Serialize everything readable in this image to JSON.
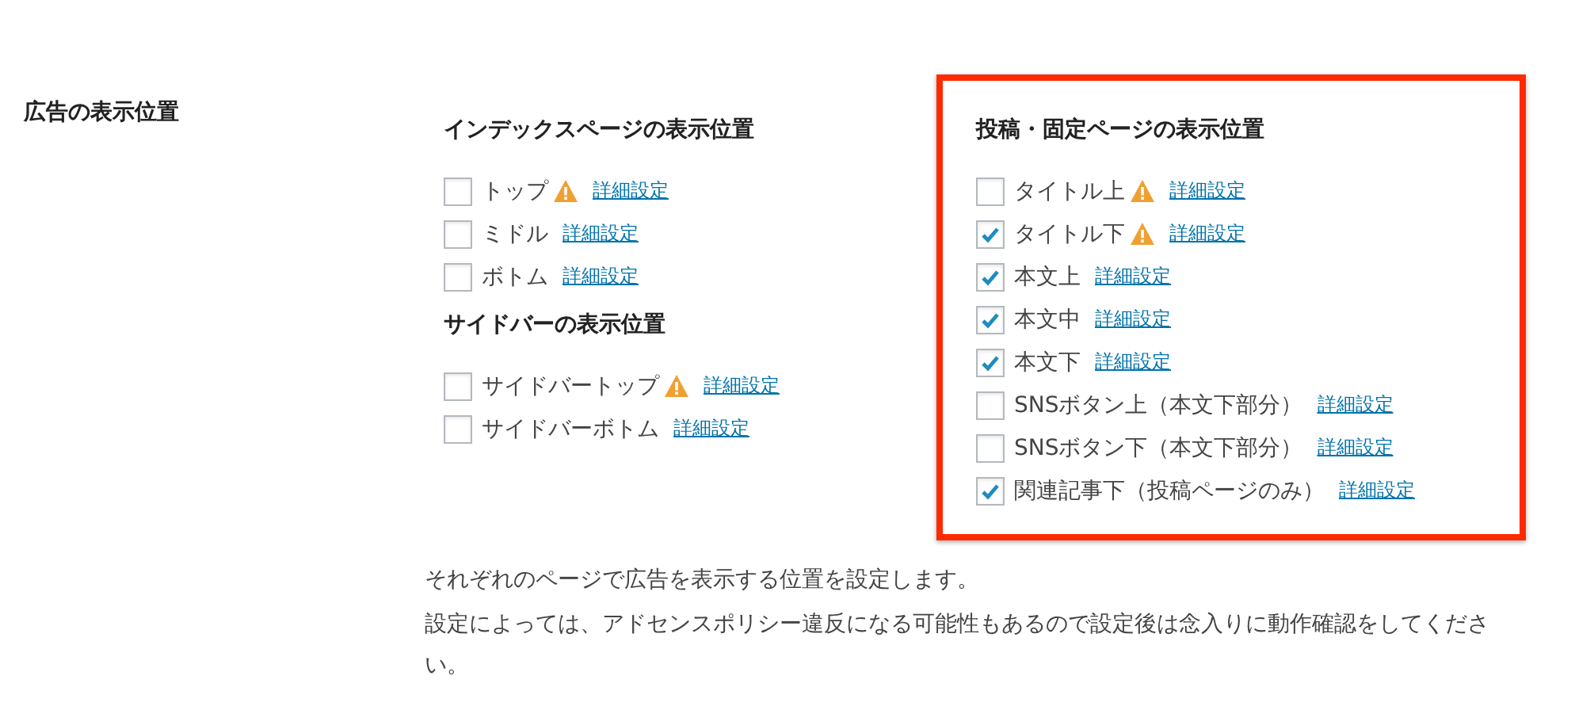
{
  "field_label": "広告の表示位置",
  "groups": [
    {
      "heading": "インデックスページの表示位置",
      "highlighted": false,
      "items": [
        {
          "label": "トップ",
          "checked": false,
          "warning": true,
          "link": "詳細設定"
        },
        {
          "label": "ミドル",
          "checked": false,
          "warning": false,
          "link": "詳細設定"
        },
        {
          "label": "ボトム",
          "checked": false,
          "warning": false,
          "link": "詳細設定"
        }
      ]
    },
    {
      "heading": "サイドバーの表示位置",
      "highlighted": false,
      "items": [
        {
          "label": "サイドバートップ",
          "checked": false,
          "warning": true,
          "link": "詳細設定"
        },
        {
          "label": "サイドバーボトム",
          "checked": false,
          "warning": false,
          "link": "詳細設定"
        }
      ]
    },
    {
      "heading": "投稿・固定ページの表示位置",
      "highlighted": true,
      "items": [
        {
          "label": "タイトル上",
          "checked": false,
          "warning": true,
          "link": "詳細設定"
        },
        {
          "label": "タイトル下",
          "checked": true,
          "warning": true,
          "link": "詳細設定"
        },
        {
          "label": "本文上",
          "checked": true,
          "warning": false,
          "link": "詳細設定"
        },
        {
          "label": "本文中",
          "checked": true,
          "warning": false,
          "link": "詳細設定"
        },
        {
          "label": "本文下",
          "checked": true,
          "warning": false,
          "link": "詳細設定"
        },
        {
          "label": "SNSボタン上（本文下部分）",
          "checked": false,
          "warning": false,
          "link": "詳細設定"
        },
        {
          "label": "SNSボタン下（本文下部分）",
          "checked": false,
          "warning": false,
          "link": "詳細設定"
        },
        {
          "label": "関連記事下（投稿ページのみ）",
          "checked": true,
          "warning": false,
          "link": "詳細設定"
        }
      ]
    }
  ],
  "description": [
    "それぞれのページで広告を表示する位置を設定します。",
    "設定によっては、アドセンスポリシー違反になる可能性もあるので設定後は念入りに動作確認をしてください。"
  ]
}
